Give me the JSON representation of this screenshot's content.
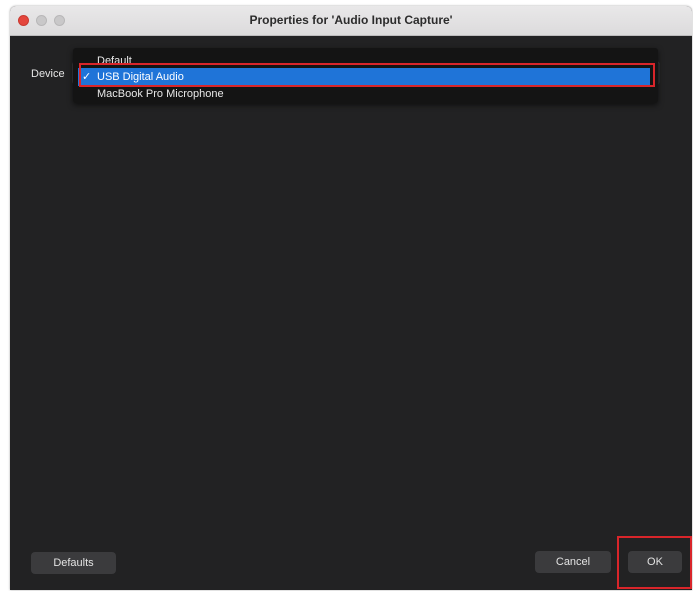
{
  "window": {
    "title": "Properties for 'Audio Input Capture'"
  },
  "device": {
    "label": "Device",
    "stepper_glyph": "↕",
    "options": [
      {
        "label": "Default",
        "selected": false
      },
      {
        "label": "USB Digital Audio",
        "selected": true
      },
      {
        "label": "MacBook Pro Microphone",
        "selected": false
      }
    ],
    "check_glyph": "✓"
  },
  "footer": {
    "defaults_label": "Defaults",
    "cancel_label": "Cancel",
    "ok_label": "OK"
  },
  "colors": {
    "window_bg": "#222223",
    "titlebar_bg": "#e3e2e3",
    "selection_blue": "#1f74d8",
    "annotation_red": "#d9252a",
    "close_red": "#e4463c"
  }
}
